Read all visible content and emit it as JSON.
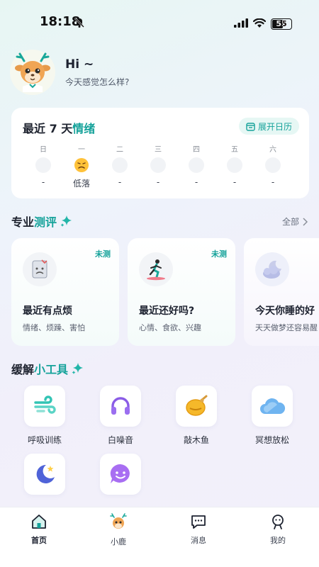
{
  "status": {
    "time": "18:18",
    "battery": "55"
  },
  "header": {
    "greeting": "Hi ~",
    "subtitle": "今天感觉怎么样?"
  },
  "mood": {
    "title_prefix": "最近 7 天",
    "title_highlight": "情绪",
    "calendar_button": "展开日历",
    "days": [
      {
        "name": "日",
        "value": "-"
      },
      {
        "name": "一",
        "value": "低落",
        "icon": "sad-face-icon"
      },
      {
        "name": "二",
        "value": "-"
      },
      {
        "name": "三",
        "value": "-"
      },
      {
        "name": "四",
        "value": "-"
      },
      {
        "name": "五",
        "value": "-"
      },
      {
        "name": "六",
        "value": "-"
      }
    ]
  },
  "assessment": {
    "title_prefix": "专业",
    "title_highlight": "测评",
    "all_label": "全部",
    "cards": [
      {
        "badge": "未测",
        "title": "最近有点烦",
        "tags": "情绪、烦躁、害怕",
        "icon": "upset-note-icon"
      },
      {
        "badge": "未测",
        "title": "最近还好吗?",
        "tags": "心情、食欲、兴趣",
        "icon": "running-person-icon"
      },
      {
        "badge": "",
        "title": "今天你睡的好",
        "tags": "天天做梦还容易醒",
        "icon": "moon-cloud-icon"
      }
    ]
  },
  "tools": {
    "title_prefix": "缓解",
    "title_highlight": "小工具",
    "items": [
      {
        "label": "呼吸训练",
        "icon": "wind-icon"
      },
      {
        "label": "白噪音",
        "icon": "headphones-icon"
      },
      {
        "label": "敲木鱼",
        "icon": "wooden-fish-icon"
      },
      {
        "label": "冥想放松",
        "icon": "cloud-icon"
      },
      {
        "label": "",
        "icon": "moon-star-icon"
      },
      {
        "label": "",
        "icon": "smile-bubble-icon"
      }
    ]
  },
  "tabbar": {
    "items": [
      {
        "label": "首页",
        "icon": "home-icon",
        "active": true
      },
      {
        "label": "小鹿",
        "icon": "deer-icon",
        "active": false
      },
      {
        "label": "消息",
        "icon": "message-icon",
        "active": false
      },
      {
        "label": "我的",
        "icon": "profile-icon",
        "active": false
      }
    ]
  },
  "colors": {
    "accent": "#15a29a",
    "card": "#ffffff"
  }
}
